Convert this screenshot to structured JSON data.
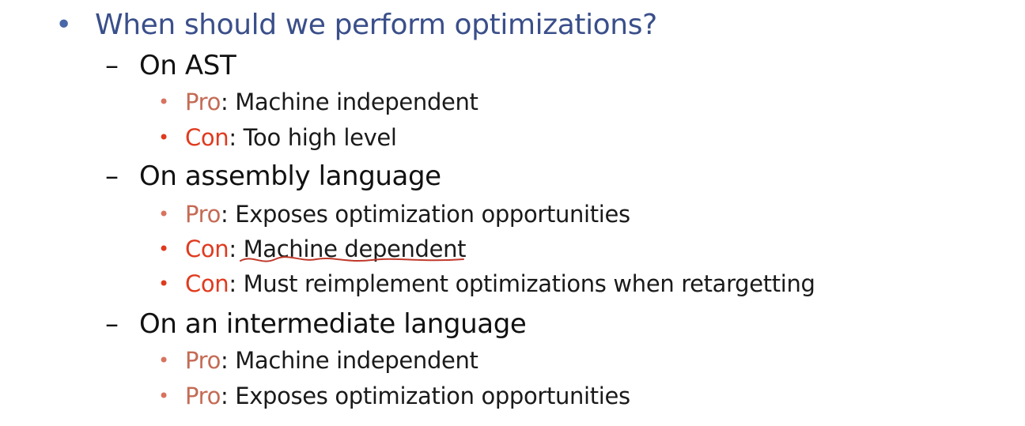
{
  "slide": {
    "bullet_symbol": "•",
    "dash_symbol": "–",
    "sub_bullet_symbol": "•",
    "heading": "When should we perform optimizations?",
    "sections": [
      {
        "title": "On AST",
        "items": [
          {
            "tag": "Pro",
            "text": ": Machine independent"
          },
          {
            "tag": "Con",
            "text": ": Too high level"
          }
        ]
      },
      {
        "title": "On assembly language",
        "items": [
          {
            "tag": "Pro",
            "text": ": Exposes optimization opportunities"
          },
          {
            "tag": "Con",
            "text": ": Machine dependent"
          },
          {
            "tag": "Con",
            "text": ": Must reimplement optimizations when retargetting"
          }
        ]
      },
      {
        "title": "On an intermediate language",
        "items": [
          {
            "tag": "Pro",
            "text": ": Machine independent"
          },
          {
            "tag": "Pro",
            "text": ": Exposes optimization opportunities"
          }
        ]
      }
    ]
  },
  "colors": {
    "heading": "#3a4f8a",
    "pro": "#c46b55",
    "con": "#e03a1e",
    "annotation": "#c0392b"
  }
}
